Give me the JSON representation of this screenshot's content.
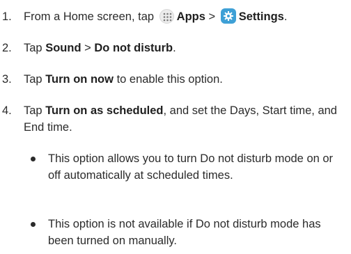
{
  "steps": [
    {
      "num": "1.",
      "pre": "From a Home screen, tap",
      "apps_label": "Apps",
      "sep": ">",
      "settings_label": "Settings",
      "end": "."
    },
    {
      "num": "2.",
      "pre": "Tap",
      "b1": "Sound",
      "sep": ">",
      "b2": "Do not disturb",
      "end": "."
    },
    {
      "num": "3.",
      "pre": "Tap",
      "b1": "Turn on now",
      "post": "to enable this option."
    },
    {
      "num": "4.",
      "pre": "Tap",
      "b1": "Turn on as scheduled",
      "post": ", and set the Days, Start time, and End time."
    }
  ],
  "bullets": [
    "This option allows you to turn Do not disturb mode on or off automatically at scheduled times.",
    "This option is not available if Do not disturb mode has been turned on manually."
  ],
  "icons": {
    "apps": "apps-grid-icon",
    "settings": "gear-icon",
    "settings_color": "#3ea0d6"
  }
}
